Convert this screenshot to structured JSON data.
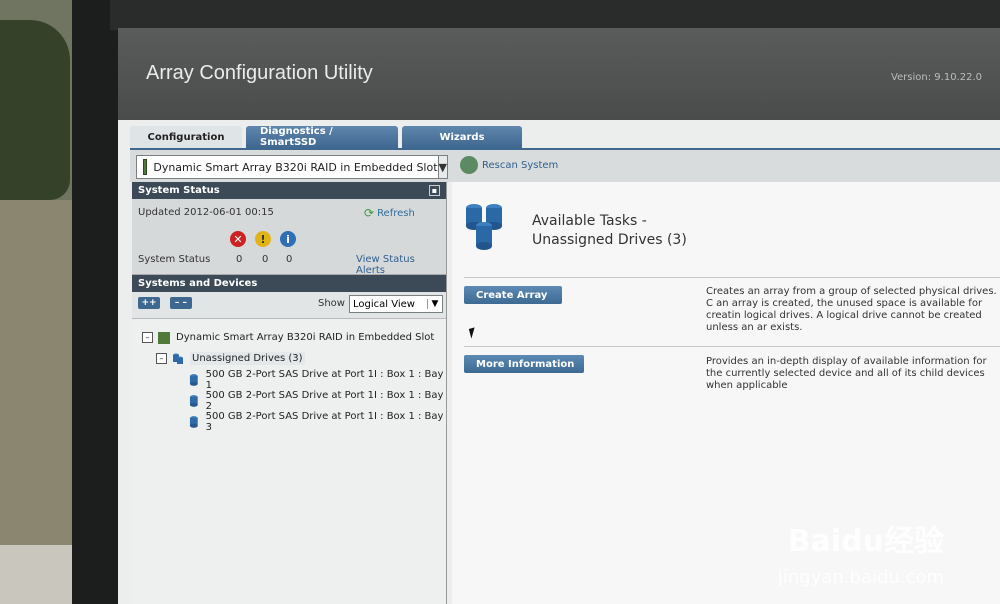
{
  "window": {
    "title": "Array Configuration Utility",
    "version": "Version: 9.10.22.0"
  },
  "tabs": [
    {
      "label": "Configuration",
      "active": true
    },
    {
      "label": "Diagnostics / SmartSSD",
      "active": false
    },
    {
      "label": "Wizards",
      "active": false
    }
  ],
  "controller_bar": {
    "selected_controller": "Dynamic Smart Array B320i RAID in Embedded Slot",
    "rescan_label": "Rescan System"
  },
  "system_status": {
    "header": "System Status",
    "updated": "Updated 2012-06-01 00:15",
    "refresh_label": "Refresh",
    "status_label": "System Status",
    "error_count": "0",
    "warning_count": "0",
    "info_count": "0",
    "view_alerts_label": "View Status Alerts"
  },
  "systems_devices": {
    "header": "Systems and Devices",
    "expand_label": "++",
    "collapse_label": "– –",
    "show_label": "Show",
    "view_selected": "Logical View",
    "tree": {
      "controller": "Dynamic Smart Array B320i RAID in Embedded Slot",
      "unassigned": "Unassigned Drives (3)",
      "drives": [
        "500 GB 2-Port SAS Drive at Port 1I : Box 1 : Bay 1",
        "500 GB 2-Port SAS Drive at Port 1I : Box 1 : Bay 2",
        "500 GB 2-Port SAS Drive at Port 1I : Box 1 : Bay 3"
      ]
    }
  },
  "tasks": {
    "title_line1": "Available Tasks -",
    "title_line2": "Unassigned Drives (3)",
    "items": [
      {
        "button": "Create Array",
        "description": "Creates an array from a group of selected physical drives. C an array is created, the unused space is available for creatin logical drives. A logical drive cannot be created unless an ar exists."
      },
      {
        "button": "More Information",
        "description": "Provides an in-depth display of available information for the currently selected device and all of its child devices when applicable"
      }
    ]
  },
  "watermark": {
    "brand": "Baidu经验",
    "url": "jingyan.baidu.com"
  }
}
